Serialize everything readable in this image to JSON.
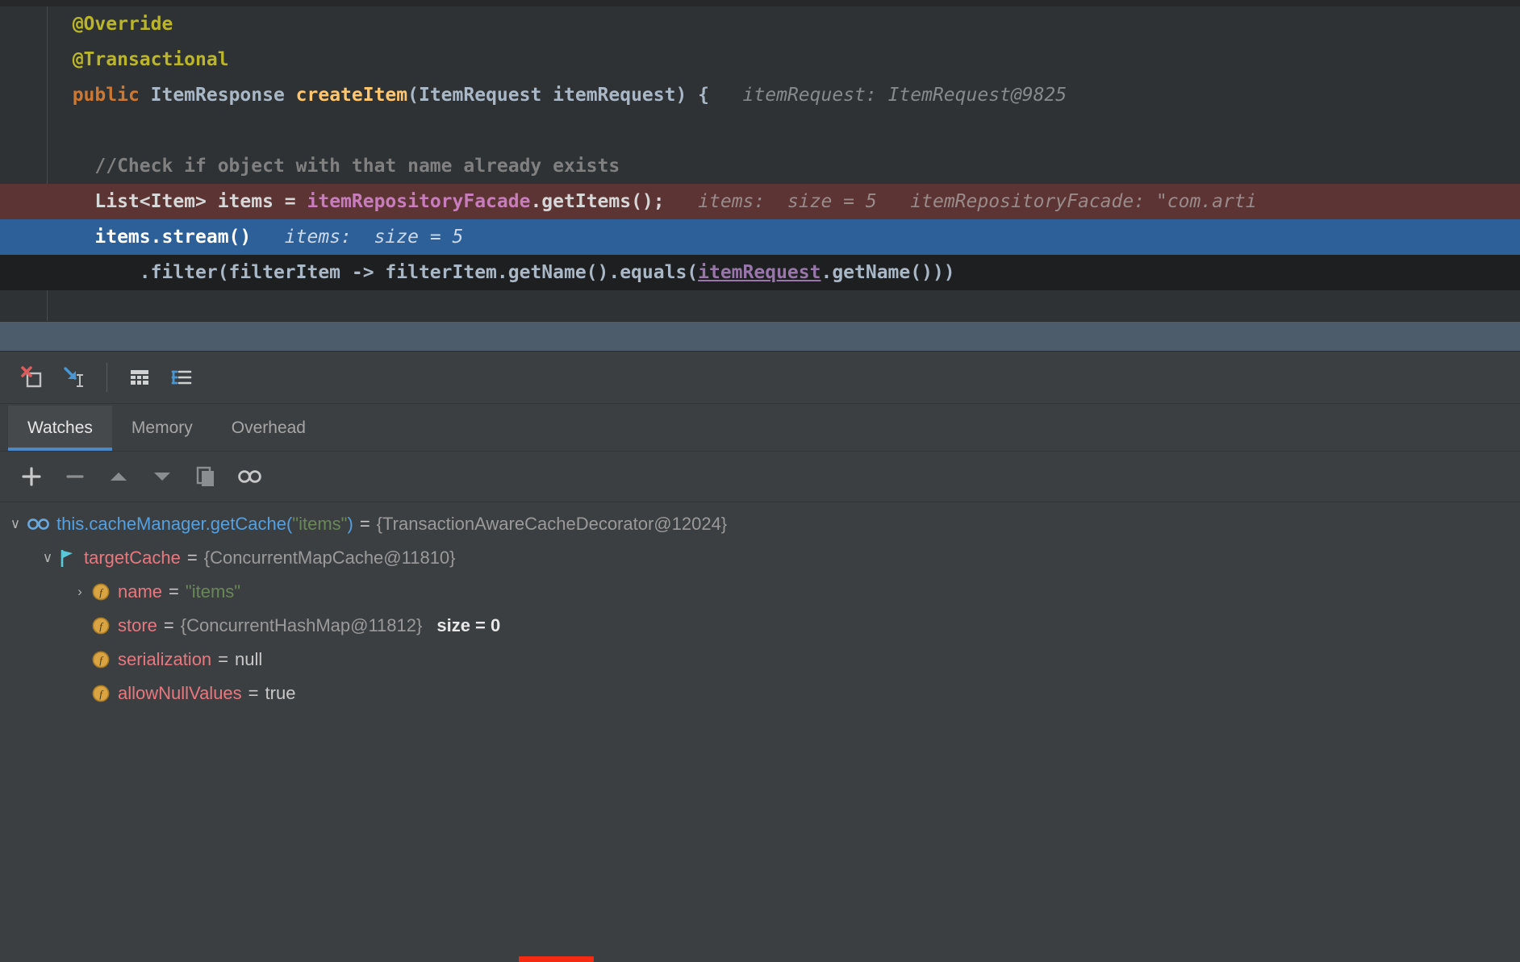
{
  "editor": {
    "lines": [
      {
        "id": "l1",
        "kind": "normal",
        "indent": 1,
        "segments": [
          {
            "t": "@Override",
            "c": "ann"
          }
        ]
      },
      {
        "id": "l2",
        "kind": "normal",
        "indent": 1,
        "segments": [
          {
            "t": "@Transactional",
            "c": "ann"
          }
        ]
      },
      {
        "id": "l3",
        "kind": "normal",
        "indent": 1,
        "segments": [
          {
            "t": "public ",
            "c": "kw"
          },
          {
            "t": "ItemResponse ",
            "c": "type"
          },
          {
            "t": "createItem",
            "c": "mth"
          },
          {
            "t": "(ItemRequest itemRequest) {",
            "c": "plain"
          }
        ],
        "hints": [
          {
            "t": "itemRequest: ItemRequest@9825"
          }
        ]
      },
      {
        "id": "l4",
        "kind": "normal",
        "indent": 1,
        "segments": []
      },
      {
        "id": "l5",
        "kind": "normal",
        "indent": 2,
        "segments": [
          {
            "t": "//Check if object with that name already exists",
            "c": "cmt"
          }
        ]
      },
      {
        "id": "l6",
        "kind": "breakpoint",
        "indent": 2,
        "segments": [
          {
            "t": "List<Item> items = ",
            "c": "bptxt"
          },
          {
            "t": "itemRepositoryFacade",
            "c": "bpfld"
          },
          {
            "t": ".getItems();",
            "c": "bptxt"
          }
        ],
        "hints": [
          {
            "t": "items:  size = 5"
          },
          {
            "t": "itemRepositoryFacade: \"com.arti"
          }
        ]
      },
      {
        "id": "l7",
        "kind": "executing",
        "indent": 2,
        "segments": [
          {
            "t": "items.stream()",
            "c": "exectxt"
          }
        ],
        "hints": [
          {
            "t": "items:  size = 5"
          }
        ]
      },
      {
        "id": "l8",
        "kind": "exec-bottom",
        "indent": 4,
        "segments": [
          {
            "t": ".filter(filterItem -> filterItem.getName().equals(",
            "c": "plain"
          },
          {
            "t": "itemRequest",
            "c": "fld-u"
          },
          {
            "t": ".getName()))",
            "c": "plain"
          }
        ]
      }
    ]
  },
  "debug": {
    "toolbar": [
      {
        "id": "mute-breakpoints",
        "name": "mute-breakpoints-icon",
        "tooltip": "Mute Breakpoints"
      },
      {
        "id": "step-into-cursor",
        "name": "run-to-cursor-icon",
        "tooltip": "Run to Cursor"
      },
      {
        "id": "table-view",
        "name": "table-view-icon",
        "tooltip": "View as Table"
      },
      {
        "id": "settings-layout",
        "name": "layout-settings-icon",
        "tooltip": "Layout Settings"
      }
    ],
    "tabs": [
      {
        "id": "watches",
        "label": "Watches",
        "active": true
      },
      {
        "id": "memory",
        "label": "Memory",
        "active": false
      },
      {
        "id": "overhead",
        "label": "Overhead",
        "active": false
      }
    ],
    "watch_toolbar": [
      {
        "id": "add",
        "name": "plus-icon",
        "glyph": "+"
      },
      {
        "id": "remove",
        "name": "minus-icon",
        "glyph": "–"
      },
      {
        "id": "move-up",
        "name": "arrow-up-icon",
        "glyph": "▲"
      },
      {
        "id": "move-down",
        "name": "arrow-down-icon",
        "glyph": "▼"
      },
      {
        "id": "duplicate",
        "name": "copy-icon",
        "glyph": "⧉"
      },
      {
        "id": "watch",
        "name": "glasses-icon",
        "glyph": "oo"
      }
    ],
    "tree": [
      {
        "id": "r1",
        "depth": 0,
        "twisty": "∨",
        "icon": "glasses",
        "name": "this.cacheManager.getCache(\"items\")",
        "name_style": "expr",
        "name_parts": [
          {
            "t": "this.cacheManager.getCache(",
            "c": "expr"
          },
          {
            "t": "\"items\"",
            "c": "str"
          },
          {
            "t": ")",
            "c": "expr"
          }
        ],
        "eq": "=",
        "value": "{TransactionAwareCacheDecorator@12024}",
        "value_style": "ref",
        "extra": ""
      },
      {
        "id": "r2",
        "depth": 1,
        "twisty": "∨",
        "icon": "flag",
        "name": "targetCache",
        "name_style": "fld",
        "eq": "=",
        "value": "{ConcurrentMapCache@11810}",
        "value_style": "ref",
        "extra": ""
      },
      {
        "id": "r3",
        "depth": 2,
        "twisty": "›",
        "icon": "field",
        "name": "name",
        "name_style": "fld",
        "eq": "=",
        "value": "\"items\"",
        "value_style": "str",
        "extra": ""
      },
      {
        "id": "r4",
        "depth": 2,
        "twisty": "",
        "icon": "field",
        "name": "store",
        "name_style": "fld",
        "eq": "=",
        "value": "{ConcurrentHashMap@11812}",
        "value_style": "ref",
        "extra": "size = 0"
      },
      {
        "id": "r5",
        "depth": 2,
        "twisty": "",
        "icon": "field",
        "name": "serialization",
        "name_style": "fld",
        "eq": "=",
        "value": "null",
        "value_style": "plain",
        "extra": ""
      },
      {
        "id": "r6",
        "depth": 2,
        "twisty": "",
        "icon": "field",
        "name": "allowNullValues",
        "name_style": "fld",
        "eq": "=",
        "value": "true",
        "value_style": "plain",
        "extra": ""
      }
    ],
    "annotation": {
      "id": "red-underline",
      "color": "#f42a12"
    }
  },
  "colors": {
    "editor_bg": "#2f3234",
    "breakpoint_line": "#5c3434",
    "executing_line": "#2d6099",
    "splitter": "#4c5c6b",
    "panel_bg": "#3c3f41",
    "accent": "#4a88c7",
    "annotation_red": "#f42a12"
  }
}
